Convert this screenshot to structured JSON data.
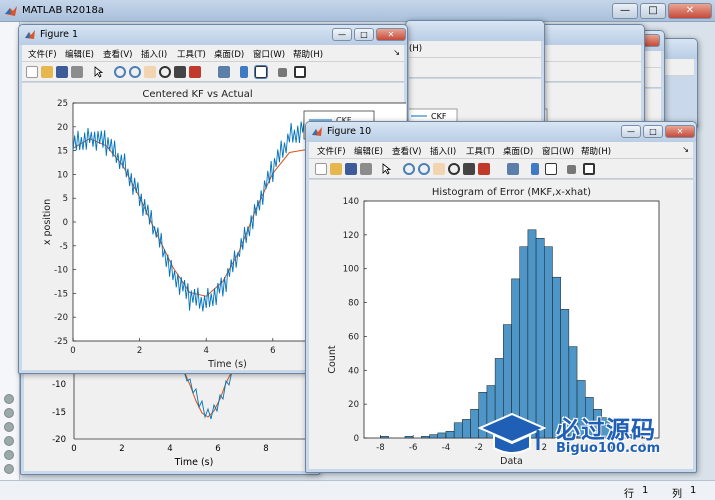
{
  "app": {
    "title": "MATLAB R2018a",
    "controls": {
      "minimize": "—",
      "maximize": "□",
      "close": "✕"
    }
  },
  "status_bar": {
    "row_label": "行",
    "row": "1",
    "col_label": "列",
    "col": "1"
  },
  "stacked_figures": {
    "menu_tail": "(H)",
    "legend_label": "CKF",
    "lower_plot": {
      "y_ticks": [
        "-10",
        "-15",
        "-20"
      ],
      "x_ticks": [
        "0",
        "2",
        "4",
        "6",
        "8"
      ],
      "xlabel": "Time (s)"
    }
  },
  "figure1": {
    "title": "Figure 1",
    "menu": [
      "文件(F)",
      "编辑(E)",
      "查看(V)",
      "插入(I)",
      "工具(T)",
      "桌面(D)",
      "窗口(W)",
      "帮助(H)"
    ],
    "menu_end_mark": "↘",
    "legend": [
      "CKF",
      "Actual"
    ]
  },
  "figure10": {
    "title": "Figure 10",
    "menu": [
      "文件(F)",
      "编辑(E)",
      "查看(V)",
      "插入(I)",
      "工具(T)",
      "桌面(D)",
      "窗口(W)",
      "帮助(H)"
    ],
    "menu_end_mark": "↘"
  },
  "chart_data": [
    {
      "type": "line",
      "title": "Centered KF vs Actual",
      "xlabel": "Time (s)",
      "ylabel": "x position",
      "xlim": [
        0,
        10
      ],
      "ylim": [
        -25,
        25
      ],
      "x_ticks": [
        0,
        2,
        4,
        6,
        8
      ],
      "y_ticks": [
        25,
        20,
        15,
        10,
        5,
        0,
        -5,
        -10,
        -15,
        -20,
        -25
      ],
      "grid": false,
      "series": [
        {
          "name": "CKF",
          "color": "#0072bd",
          "x": [
            0,
            0.5,
            1,
            1.5,
            2,
            2.5,
            3,
            3.5,
            4,
            4.5,
            5,
            5.5,
            6,
            6.5,
            7,
            7.5,
            8,
            8.5,
            9,
            9.6
          ],
          "y": [
            15.8,
            18.3,
            16.5,
            12.5,
            5.5,
            -2.5,
            -10.5,
            -16,
            -16.8,
            -13.5,
            -6.5,
            3,
            11,
            18,
            20,
            17,
            9,
            2,
            -7,
            -18
          ]
        },
        {
          "name": "Actual",
          "color": "#d95319",
          "x": [
            0,
            0.5,
            1,
            1.5,
            2,
            2.5,
            3,
            3.5,
            4,
            4.5,
            5,
            5.5,
            6,
            6.5,
            7,
            7.5,
            8,
            8.5,
            9,
            9.6
          ],
          "y": [
            15.5,
            17.5,
            16,
            11.8,
            5.2,
            -2.3,
            -9.5,
            -14.8,
            -15.6,
            -12.5,
            -6,
            2.8,
            10.2,
            14.6,
            15.2,
            12.5,
            6.8,
            -0.5,
            -8,
            -16
          ]
        }
      ]
    },
    {
      "type": "bar",
      "title": "Histogram of Error (MKF,x-xhat)",
      "xlabel": "Data",
      "ylabel": "Count",
      "xlim": [
        -9,
        9
      ],
      "ylim": [
        0,
        140
      ],
      "x_ticks": [
        -8,
        -6,
        -4,
        -2,
        0,
        2,
        4,
        6,
        8
      ],
      "y_ticks": [
        0,
        20,
        40,
        60,
        80,
        100,
        120,
        140
      ],
      "bin_width": 0.5,
      "bin_start": -8,
      "bar_color": "#4d96c7",
      "values": [
        1,
        0,
        0,
        1,
        0,
        1,
        2,
        3,
        4,
        9,
        11,
        17,
        27,
        31,
        47,
        67,
        94,
        113,
        123,
        118,
        113,
        95,
        76,
        54,
        34,
        24,
        17,
        12,
        7,
        5,
        2,
        1
      ]
    }
  ],
  "watermark": {
    "cn": "必过源码",
    "en": "Biguo100.com"
  }
}
